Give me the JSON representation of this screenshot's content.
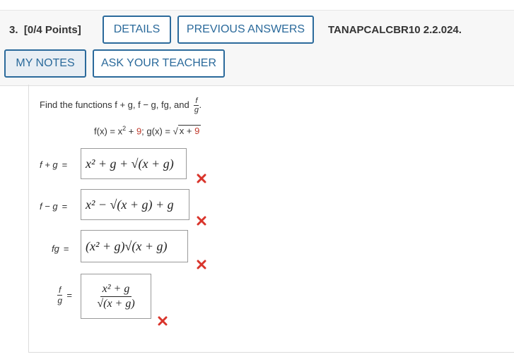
{
  "header": {
    "question_number": "3.",
    "points": "[0/4 Points]",
    "details_label": "DETAILS",
    "previous_answers_label": "PREVIOUS ANSWERS",
    "problem_code": "TANAPCALCBR10 2.2.024.",
    "my_notes_label": "MY NOTES",
    "ask_teacher_label": "ASK YOUR TEACHER"
  },
  "problem": {
    "prompt_text": "Find the functions f + g, f − g, fg, and",
    "prompt_frac_num": "f",
    "prompt_frac_den": "g",
    "given_f": "f(x) = x",
    "given_f_exp": "2",
    "given_f_rest": " + ",
    "given_const": "9",
    "given_sep": "; g(x) = ",
    "given_sqrt": "x + ",
    "given_sqrt_const": "9"
  },
  "answers": [
    {
      "label": "f + g",
      "eq": "=",
      "value": "x² + g + √(x + g)",
      "status": "incorrect"
    },
    {
      "label": "f − g",
      "eq": "=",
      "value": "x² − √(x + g) + g",
      "status": "incorrect"
    },
    {
      "label": "fg",
      "eq": "=",
      "value": "(x² + g)√(x + g)",
      "status": "incorrect"
    },
    {
      "label_num": "f",
      "label_den": "g",
      "eq": "=",
      "value_num": "x² + g",
      "value_den": "√(x + g)",
      "status": "incorrect"
    }
  ],
  "colors": {
    "accent": "#2b6a9b",
    "error": "#d9342b"
  },
  "icons": {
    "incorrect": "x-mark-icon"
  }
}
